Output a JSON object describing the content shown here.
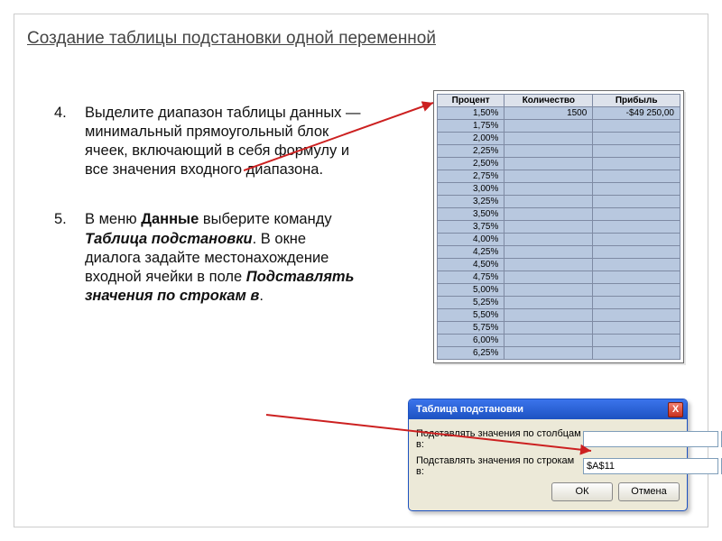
{
  "title": "Создание таблицы подстановки одной переменной",
  "items": {
    "n4": {
      "num": "4.",
      "text_a": "Выделите диапазон таблицы данных — минимальный прямоугольный блок ячеек, включающий в себя формулу и все значения входного диапазона."
    },
    "n5": {
      "num": "5.",
      "t1": "В меню ",
      "t2": "Данные",
      "t3": " выберите команду ",
      "t4": "Таблица подстановки",
      "t5": ". В окне диалога задайте местонахождение входной ячейки в поле ",
      "t6": "Подставлять значения по строкам в",
      "t7": "."
    }
  },
  "chart_data": {
    "type": "table",
    "headers": [
      "Процент",
      "Количество",
      "Прибыль"
    ],
    "first_row": {
      "pct": "1,50%",
      "qty": "1500",
      "profit": "-$49 250,00"
    },
    "pct_column": [
      "1,75%",
      "2,00%",
      "2,25%",
      "2,50%",
      "2,75%",
      "3,00%",
      "3,25%",
      "3,50%",
      "3,75%",
      "4,00%",
      "4,25%",
      "4,50%",
      "4,75%",
      "5,00%",
      "5,25%",
      "5,50%",
      "5,75%",
      "6,00%",
      "6,25%"
    ]
  },
  "dialog": {
    "title": "Таблица подстановки",
    "close": "X",
    "field_col_label": "Подставлять значения по столбцам в:",
    "field_col_u": "с",
    "field_col_val": "",
    "field_row_label": "Подставлять значения по строкам в:",
    "field_row_u": "с",
    "field_row_label2": "трокам в:",
    "field_row_val": "$A$11",
    "ok": "ОК",
    "cancel": "Отмена"
  }
}
